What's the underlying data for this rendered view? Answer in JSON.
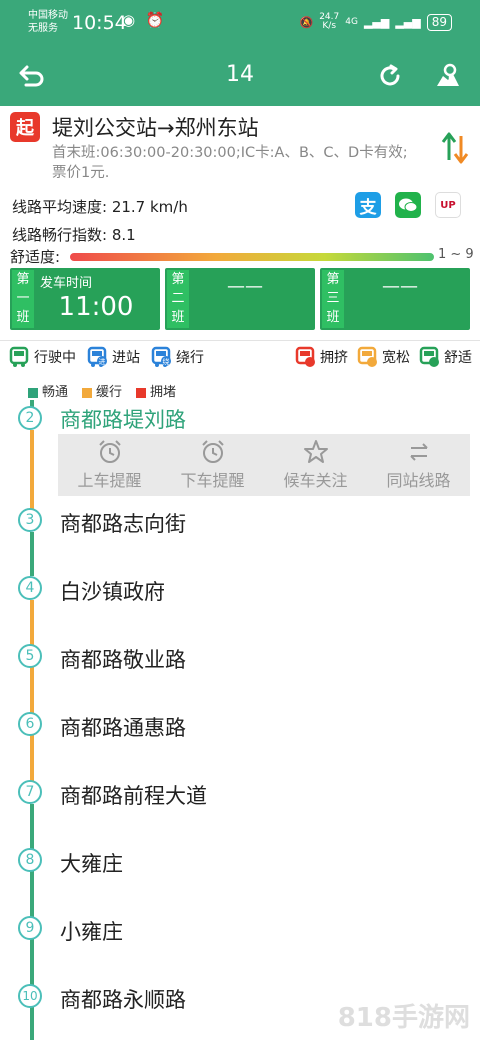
{
  "status_bar": {
    "carrier": "中国移动",
    "carrier_sub": "无服务",
    "time": "10:54",
    "speed": "24.7",
    "speed_unit": "K/s",
    "network": "4G",
    "battery": "89"
  },
  "header": {
    "title": "14"
  },
  "route": {
    "start_badge": "起",
    "name": "堤刘公交站→郑州东站",
    "info": "首末班:06:30:00-20:30:00;IC卡:A、B、C、D卡有效;票价1元."
  },
  "stats": {
    "avg_speed": "线路平均速度: 21.7 km/h",
    "smooth_index": "线路畅行指数: 8.1",
    "comfort_label": "舒适度:",
    "comfort_range": "1 ~ 9"
  },
  "payments": [
    "alipay",
    "wechat",
    "unionpay"
  ],
  "pay_glyphs": {
    "alipay": "支",
    "unionpay": "UP"
  },
  "shifts": [
    {
      "tag": "第一班",
      "label": "发车时间",
      "value": "11:00"
    },
    {
      "tag": "第二班",
      "value": "——"
    },
    {
      "tag": "第三班",
      "value": "——"
    }
  ],
  "bus_legend": [
    {
      "label": "行驶中",
      "color": "#27a158"
    },
    {
      "label": "进站",
      "badge": "进",
      "color": "#2b82d9"
    },
    {
      "label": "绕行",
      "badge": "绕",
      "color": "#2b82d9"
    }
  ],
  "crowd_legend": [
    {
      "label": "拥挤",
      "color": "#e8392b"
    },
    {
      "label": "宽松",
      "color": "#f2a93b"
    },
    {
      "label": "舒适",
      "color": "#27a158"
    }
  ],
  "traffic_legend": [
    {
      "label": "畅通",
      "color": "#2fa37a"
    },
    {
      "label": "缓行",
      "color": "#f2a93b"
    },
    {
      "label": "拥堵",
      "color": "#e8392b"
    }
  ],
  "stops": [
    {
      "num": "2",
      "name": "商都路堤刘路"
    },
    {
      "num": "3",
      "name": "商都路志向街"
    },
    {
      "num": "4",
      "name": "白沙镇政府"
    },
    {
      "num": "5",
      "name": "商都路敬业路"
    },
    {
      "num": "6",
      "name": "商都路通惠路"
    },
    {
      "num": "7",
      "name": "商都路前程大道"
    },
    {
      "num": "8",
      "name": "大雍庄"
    },
    {
      "num": "9",
      "name": "小雍庄"
    },
    {
      "num": "10",
      "name": "商都路永顺路"
    }
  ],
  "stop_actions": [
    "上车提醒",
    "下车提醒",
    "候车关注",
    "同站线路"
  ],
  "watermark": "818手游网",
  "colors": {
    "primary": "#3aa87a",
    "active_stop": "#2fa37a",
    "line_green": "#3aa87a",
    "line_orange": "#f2a93b"
  }
}
